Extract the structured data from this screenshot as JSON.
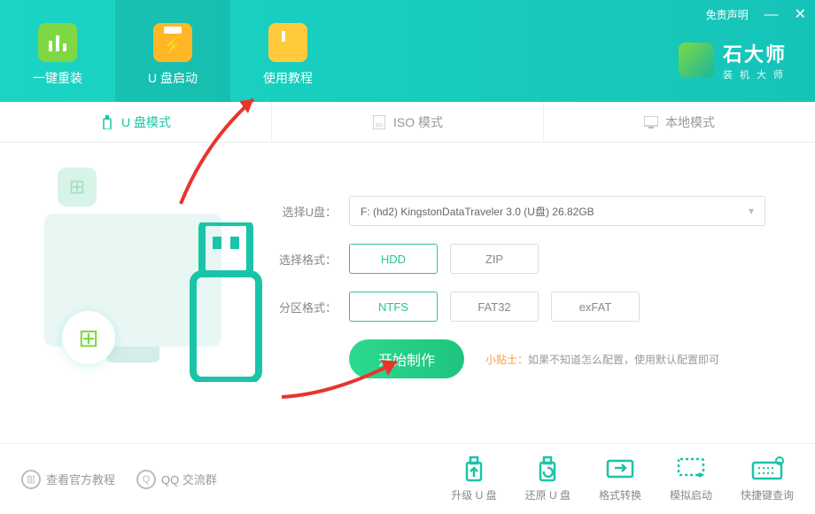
{
  "window": {
    "disclaimer": "免责声明",
    "brand_title": "石大师",
    "brand_sub": "装机大师"
  },
  "nav": {
    "reinstall": "一键重装",
    "usb_boot": "U 盘启动",
    "tutorial": "使用教程"
  },
  "tabs": {
    "usb_mode": "U 盘模式",
    "iso_mode": "ISO 模式",
    "local_mode": "本地模式"
  },
  "form": {
    "select_disk_label": "选择U盘：",
    "select_disk_value": "F: (hd2) KingstonDataTraveler 3.0 (U盘) 26.82GB",
    "format_label": "选择格式：",
    "format_options": [
      "HDD",
      "ZIP"
    ],
    "format_selected": "HDD",
    "fs_label": "分区格式：",
    "fs_options": [
      "NTFS",
      "FAT32",
      "exFAT"
    ],
    "fs_selected": "NTFS",
    "start_button": "开始制作",
    "tip_label": "小贴士：",
    "tip_text": "如果不知道怎么配置，使用默认配置即可"
  },
  "bottom_left": {
    "official_tutorial": "查看官方教程",
    "qq_group": "QQ 交流群"
  },
  "bottom_right": {
    "upgrade": "升级 U 盘",
    "restore": "还原 U 盘",
    "convert": "格式转换",
    "simulate": "模拟启动",
    "hotkey": "快捷键查询"
  }
}
